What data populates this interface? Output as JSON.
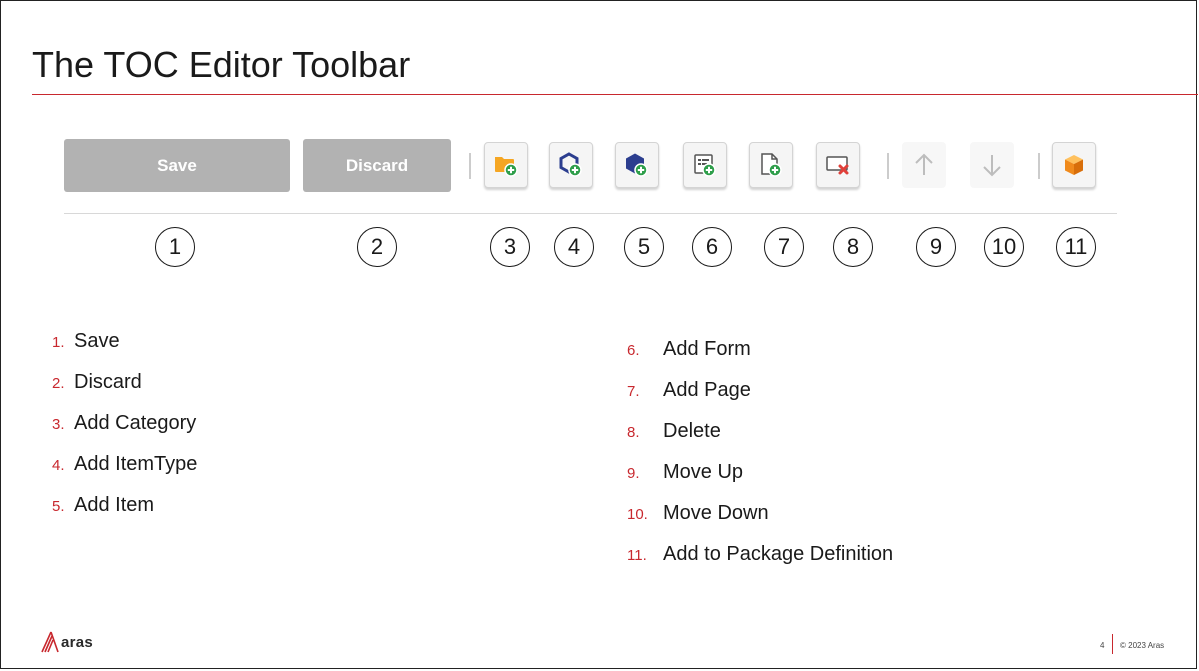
{
  "slide": {
    "title": "The TOC Editor Toolbar"
  },
  "toolbar": {
    "save_label": "Save",
    "discard_label": "Discard",
    "icons": {
      "add_category": "folder-add-icon",
      "add_itemtype": "itemtype-add-icon",
      "add_item": "item-add-icon",
      "add_form": "form-add-icon",
      "add_page": "page-add-icon",
      "delete": "delete-icon",
      "move_up": "arrow-up-icon",
      "move_down": "arrow-down-icon",
      "add_to_package": "package-icon"
    }
  },
  "numbers": [
    "1",
    "2",
    "3",
    "4",
    "5",
    "6",
    "7",
    "8",
    "9",
    "10",
    "11"
  ],
  "list_left": [
    {
      "marker": "1.",
      "label": "Save"
    },
    {
      "marker": "2.",
      "label": "Discard"
    },
    {
      "marker": "3.",
      "label": "Add Category"
    },
    {
      "marker": "4.",
      "label": "Add ItemType"
    },
    {
      "marker": "5.",
      "label": "Add Item"
    }
  ],
  "list_right": [
    {
      "marker": "6.",
      "label": "Add Form"
    },
    {
      "marker": "7.",
      "label": "Add Page"
    },
    {
      "marker": "8.",
      "label": "Delete"
    },
    {
      "marker": "9.",
      "label": "Move Up"
    },
    {
      "marker": "10.",
      "label": "Move Down"
    },
    {
      "marker": "11.",
      "label": "Add to Package Definition"
    }
  ],
  "footer": {
    "logo_text": "aras",
    "page_number": "4",
    "copyright": "© 2023 Aras"
  },
  "colors": {
    "accent": "#c8282e",
    "folder": "#f5a623",
    "plus_green": "#2e9e4a",
    "hex_blue": "#2c3e8f",
    "delete_red": "#e0403a",
    "package_orange": "#f08a1c",
    "disabled_button": "#b2b2b2"
  }
}
